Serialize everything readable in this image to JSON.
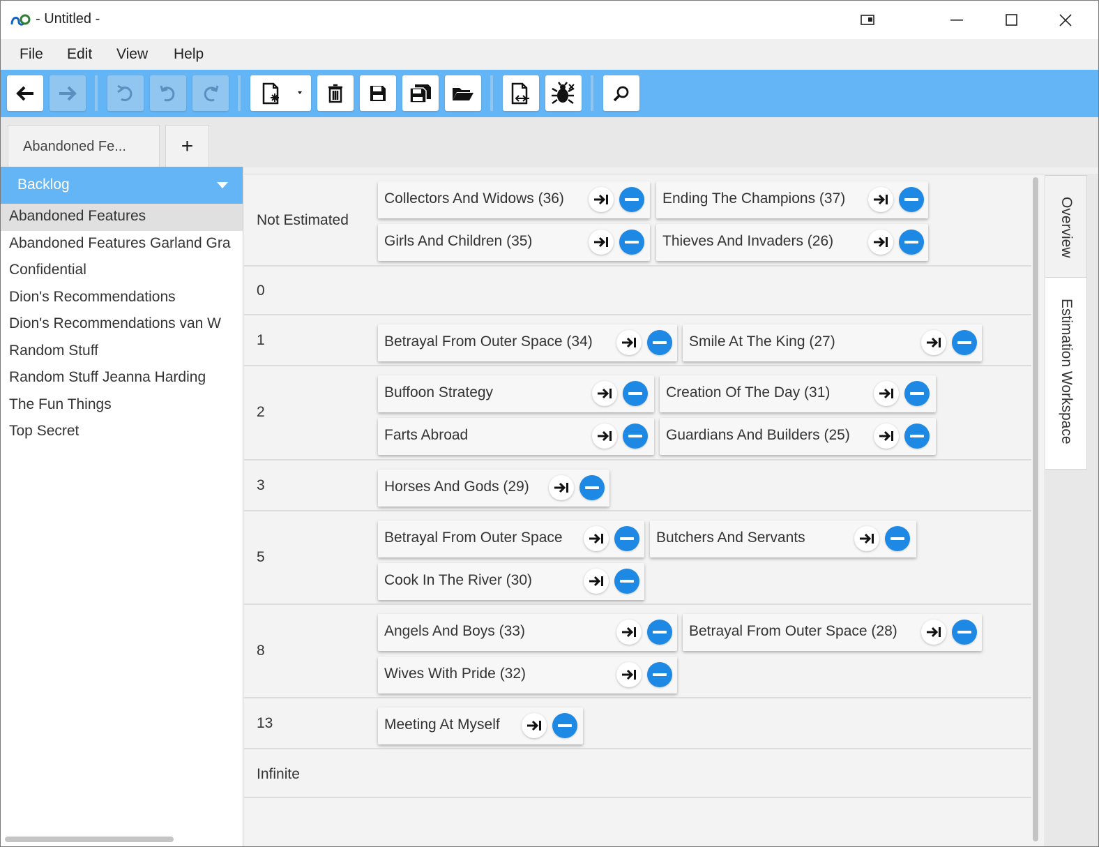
{
  "window": {
    "title": "- Untitled -",
    "controls": {
      "restore_icon": "taskbar-pin-icon",
      "minimize_icon": "minimize-icon",
      "maximize_icon": "maximize-icon",
      "close_icon": "close-icon"
    }
  },
  "menu": {
    "items": [
      "File",
      "Edit",
      "View",
      "Help"
    ]
  },
  "toolbar": {
    "buttons": [
      {
        "icon": "back-arrow-icon",
        "enabled": true
      },
      {
        "icon": "forward-arrow-icon",
        "enabled": false
      },
      {
        "icon": "undo-icon",
        "enabled": false
      },
      {
        "icon": "undo-all-icon",
        "enabled": false
      },
      {
        "icon": "redo-icon",
        "enabled": false
      },
      {
        "icon": "new-document-dropdown-icon",
        "enabled": true
      },
      {
        "icon": "trash-icon",
        "enabled": true
      },
      {
        "icon": "save-icon",
        "enabled": true
      },
      {
        "icon": "save-all-icon",
        "enabled": true
      },
      {
        "icon": "open-folder-icon",
        "enabled": true
      },
      {
        "icon": "export-document-icon",
        "enabled": true
      },
      {
        "icon": "bug-icon",
        "enabled": true
      },
      {
        "icon": "search-icon",
        "enabled": true
      }
    ]
  },
  "tabs": {
    "active_label": "Abandoned Fe...",
    "add_label": "+"
  },
  "backlog": {
    "selector_label": "Backlog",
    "items": [
      {
        "label": "Abandoned Features",
        "selected": true
      },
      {
        "label": "Abandoned Features Garland Gra",
        "selected": false
      },
      {
        "label": "Confidential",
        "selected": false
      },
      {
        "label": "Dion's Recommendations",
        "selected": false
      },
      {
        "label": "Dion's Recommendations van W",
        "selected": false
      },
      {
        "label": "Random Stuff",
        "selected": false
      },
      {
        "label": "Random Stuff Jeanna Harding",
        "selected": false
      },
      {
        "label": "The Fun Things",
        "selected": false
      },
      {
        "label": "Top Secret",
        "selected": false
      }
    ]
  },
  "estimation": {
    "rows": [
      {
        "label": "Not Estimated",
        "cards": [
          "Collectors And Widows (36)",
          "Ending The Champions (37)",
          "Girls And Children (35)",
          "Thieves And Invaders (26)"
        ]
      },
      {
        "label": "0",
        "cards": []
      },
      {
        "label": "1",
        "cards": [
          "Betrayal From Outer Space (34)",
          "Smile At The King (27)"
        ]
      },
      {
        "label": "2",
        "cards": [
          "Buffoon Strategy",
          "Creation Of The Day (31)",
          "Farts Abroad",
          "Guardians And Builders (25)"
        ]
      },
      {
        "label": "3",
        "cards": [
          "Horses And Gods (29)"
        ]
      },
      {
        "label": "5",
        "cards": [
          "Betrayal From Outer Space",
          "Butchers And Servants",
          "Cook In The River (30)"
        ]
      },
      {
        "label": "8",
        "cards": [
          "Angels And Boys (33)",
          "Betrayal From Outer Space (28)",
          "Wives With Pride (32)"
        ]
      },
      {
        "label": "13",
        "cards": [
          "Meeting At Myself"
        ]
      },
      {
        "label": "Infinite",
        "cards": []
      }
    ],
    "card_actions": {
      "move_icon": "move-to-end-icon",
      "remove_icon": "remove-circle-icon"
    }
  },
  "side_tabs": [
    "Overview",
    "Estimation Workspace"
  ],
  "colors": {
    "accent": "#64b5f6",
    "remove_button": "#1e88e5"
  }
}
